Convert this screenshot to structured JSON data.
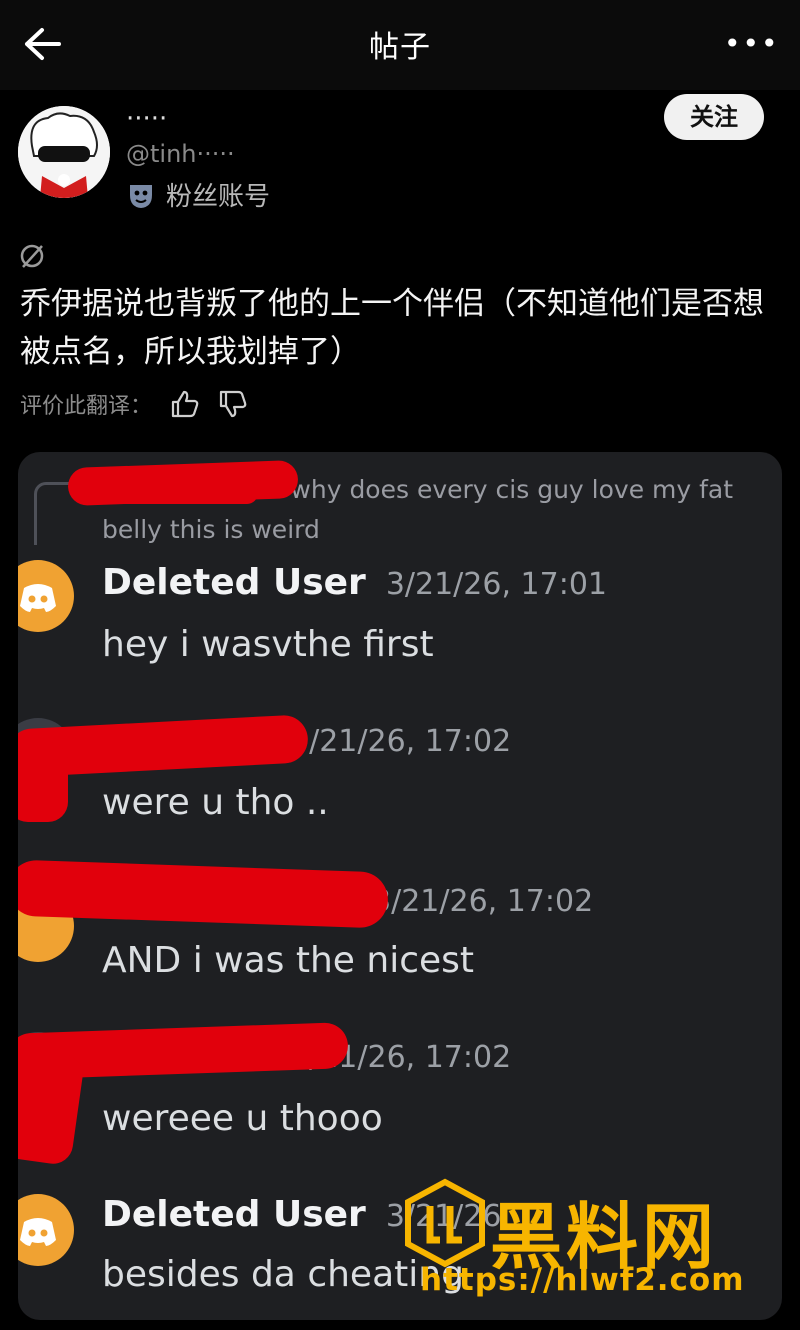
{
  "header": {
    "title": "帖子"
  },
  "post": {
    "user_name": "·····",
    "handle": "@tinh·····",
    "fan_label": "粉丝账号",
    "follow_label": "关注",
    "text": "乔伊据说也背叛了他的上一个伴侣（不知道他们是否想被点名，所以我划掉了）",
    "rate_label": "评价此翻译："
  },
  "screenshot": {
    "reply_prefix": "°.",
    "reply_text": "why does every cis guy love my fat belly this is weird",
    "messages": [
      {
        "author": "Deleted User",
        "time": "3/21/26, 17:01",
        "text": "hey i wasvthe first"
      },
      {
        "author": "",
        "time": "3/21/26, 17:02",
        "text": "were u tho .."
      },
      {
        "author": "",
        "time": "3/21/26, 17:02",
        "text": "AND i was the nicest"
      },
      {
        "author": "",
        "time": "3/21/26, 17:02",
        "text": "wereee u thooo"
      },
      {
        "author": "Deleted User",
        "time": "3/21/26",
        "text": "besides da cheating"
      }
    ]
  },
  "watermark": {
    "name": "黑料网",
    "url": "https://hlwf2.com"
  },
  "colors": {
    "discord_orange": "#f0a232",
    "redaction": "#e1000c",
    "watermark": "#f7b500"
  },
  "icons": [
    "back-arrow-icon",
    "more-icon",
    "mask-icon",
    "no-symbol-icon",
    "thumbs-up-icon",
    "thumbs-down-icon",
    "discord-icon"
  ]
}
